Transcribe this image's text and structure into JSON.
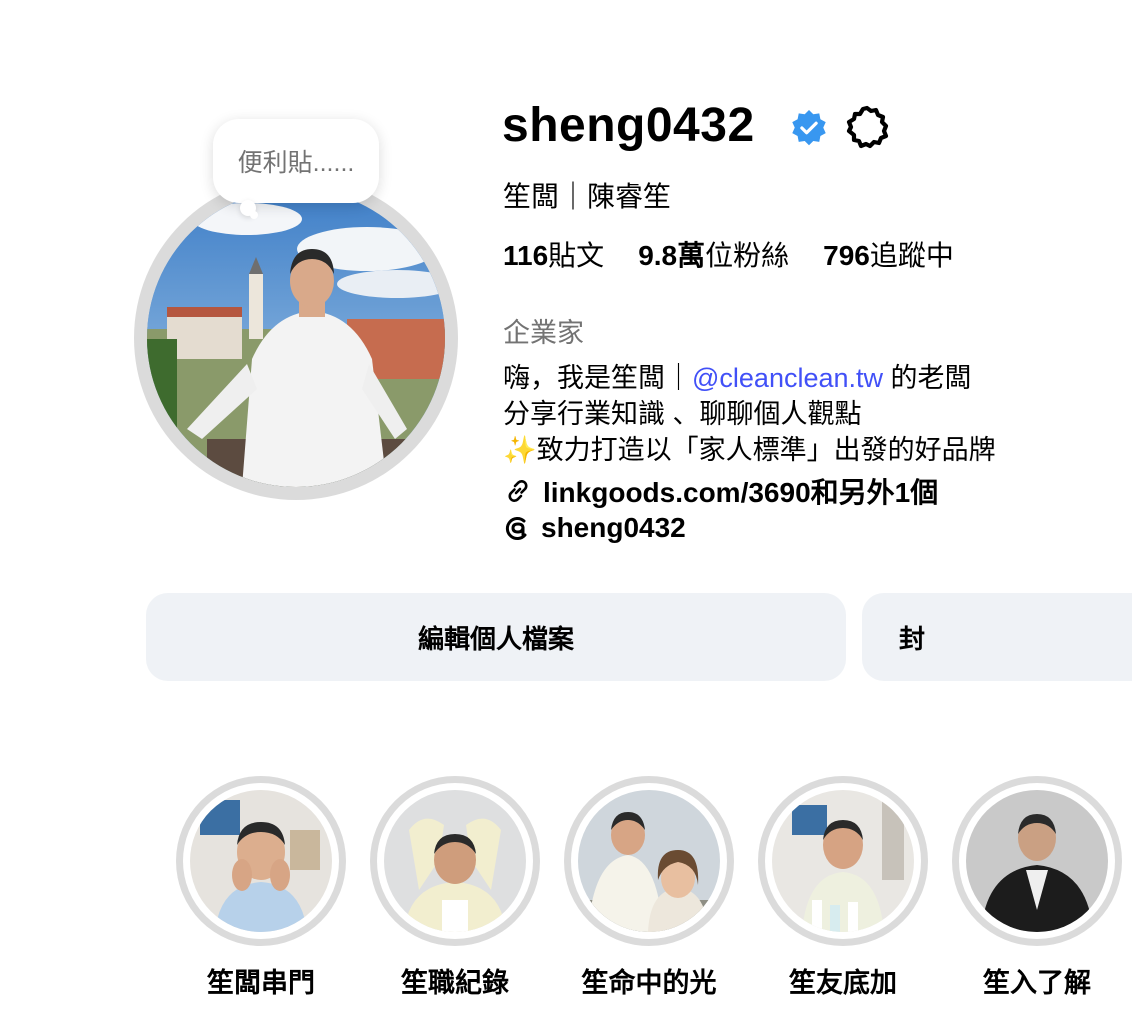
{
  "profile": {
    "username": "sheng0432",
    "full_name": "笙闆｜陳睿笙",
    "note": "便利貼......",
    "stats": [
      {
        "value": "116",
        "label": "貼文"
      },
      {
        "value": "9.8萬",
        "label": "位粉絲"
      },
      {
        "value": "796",
        "label": "追蹤中"
      }
    ],
    "category": "企業家",
    "bio": {
      "line1_prefix": "嗨，我是笙闆｜",
      "line1_mention": "@cleanclean.tw",
      "line1_suffix": " 的老闆",
      "line2": "分享行業知識 、聊聊個人觀點",
      "line3": "✨致力打造以「家人標準」出發的好品牌"
    },
    "link_text": "linkgoods.com/3690和另外1個",
    "threads_handle": "sheng0432"
  },
  "buttons": {
    "edit_profile": "編輯個人檔案",
    "second": "封"
  },
  "highlights": [
    {
      "label": "笙闆串門"
    },
    {
      "label": "笙職紀錄"
    },
    {
      "label": "笙命中的光"
    },
    {
      "label": "笙友底加"
    },
    {
      "label": "笙入了解"
    }
  ],
  "colors": {
    "verified_badge": "#3897f0",
    "mention_link": "#4150f7",
    "secondary_text": "#737373",
    "button_bg": "#eff2f6",
    "ring": "#dbdbdb"
  },
  "icons": {
    "verified": "verified-badge-icon",
    "settings": "gear-icon",
    "link": "link-icon",
    "threads": "threads-icon"
  }
}
